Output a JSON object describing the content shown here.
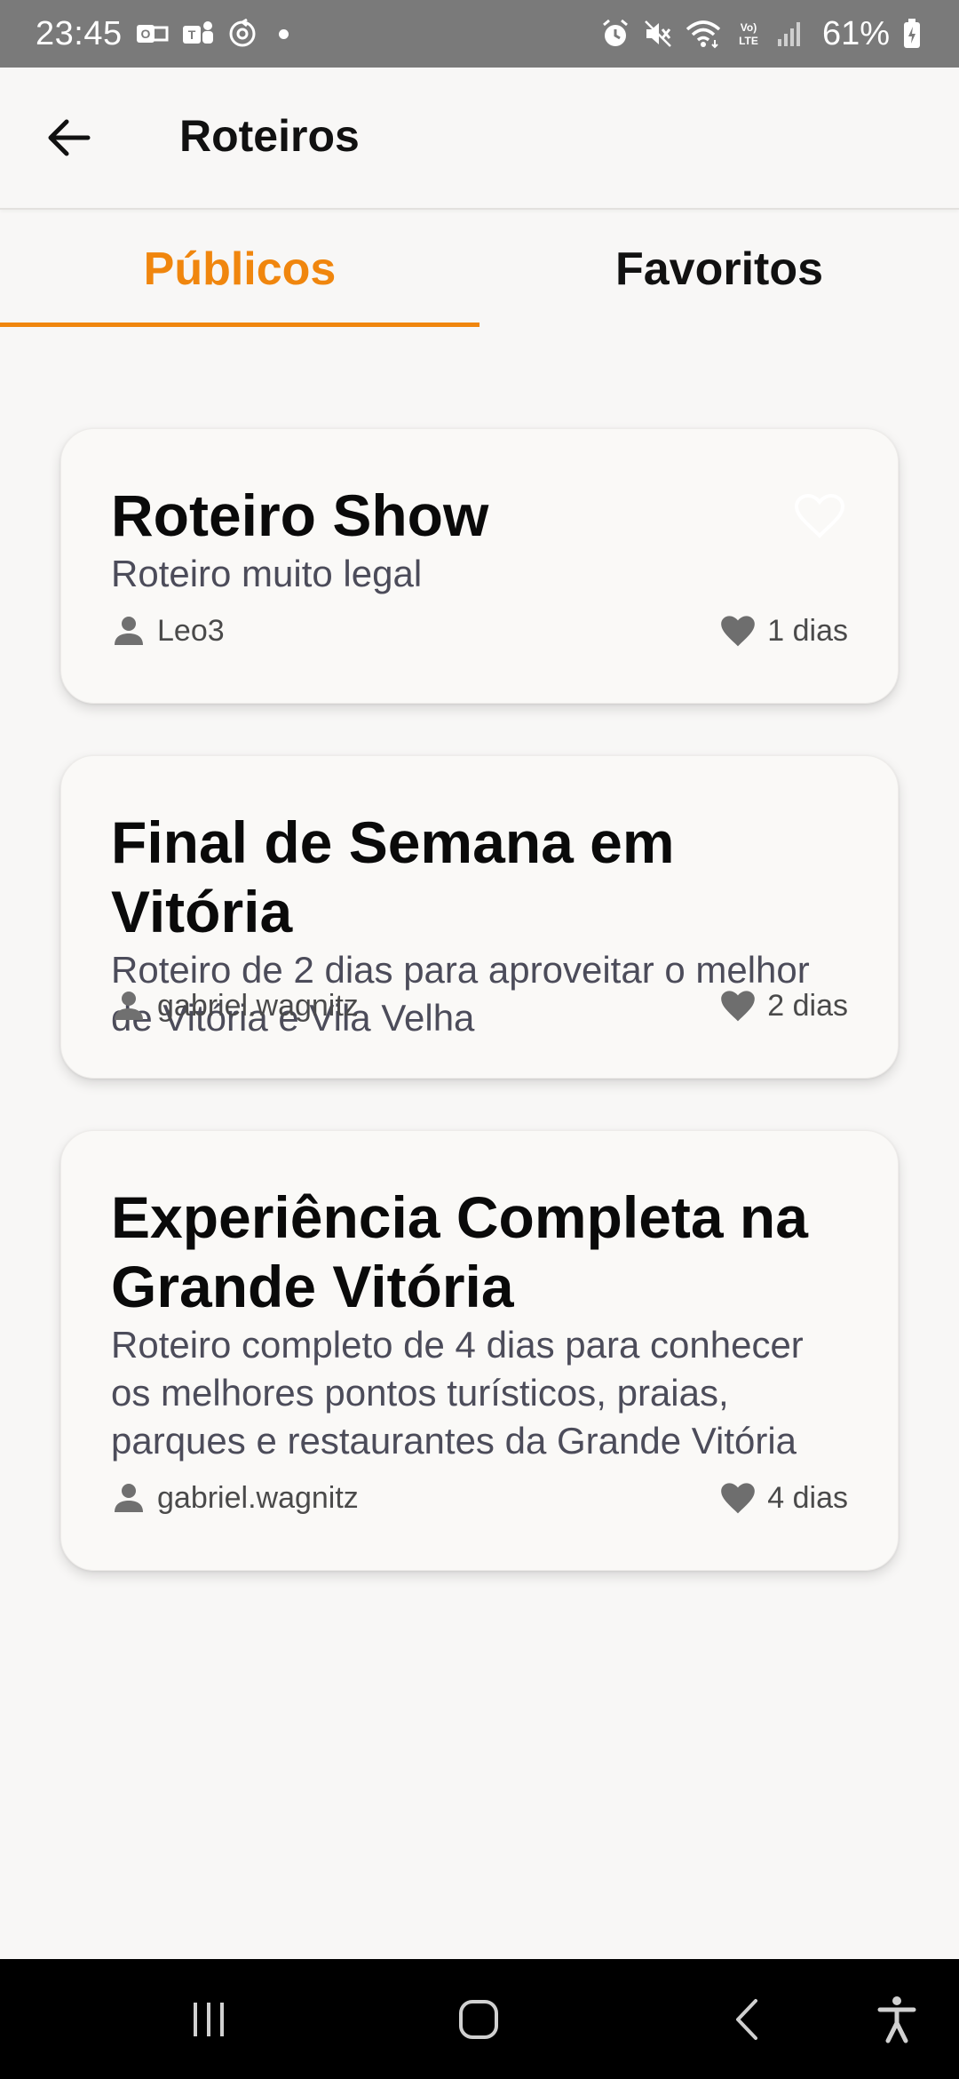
{
  "status_bar": {
    "time": "23:45",
    "battery": "61%",
    "icons_left": [
      "outlook-icon",
      "teams-icon",
      "sync-icon",
      "dot"
    ],
    "icons_right": [
      "alarm-icon",
      "mute-icon",
      "wifi-icon",
      "volte-icon",
      "signal-icon",
      "battery-icon"
    ]
  },
  "app_bar": {
    "title": "Roteiros",
    "back_icon": "arrow-left-icon"
  },
  "tabs": [
    {
      "label": "Públicos",
      "active": true
    },
    {
      "label": "Favoritos",
      "active": false
    }
  ],
  "colors": {
    "accent": "#f0860e",
    "background": "#f8f7f6",
    "card": "#faf9f7",
    "text": "#111111",
    "description": "#4c4c5a",
    "nav_bar": "#000000"
  },
  "cards": [
    {
      "title": "Roteiro Show",
      "description": "Roteiro muito legal",
      "author": "Leo3",
      "days": "1 dias",
      "favorite_button_shown": true
    },
    {
      "title": "Final de Semana em Vitória",
      "description": "Roteiro de 2 dias para aproveitar o melhor de Vitória e Vila Velha",
      "author": "gabriel.wagnitz",
      "days": "2 dias",
      "favorite_button_shown": false
    },
    {
      "title": "Experiência Completa na Grande Vitória",
      "description": "Roteiro completo de 4 dias para conhecer os melhores pontos turísticos, praias, parques e restaurantes da Grande Vitória",
      "author": "gabriel.wagnitz",
      "days": "4 dias",
      "favorite_button_shown": false
    }
  ],
  "nav_bar": {
    "buttons": [
      "recent-apps-icon",
      "home-icon",
      "back-icon",
      "accessibility-icon"
    ]
  }
}
